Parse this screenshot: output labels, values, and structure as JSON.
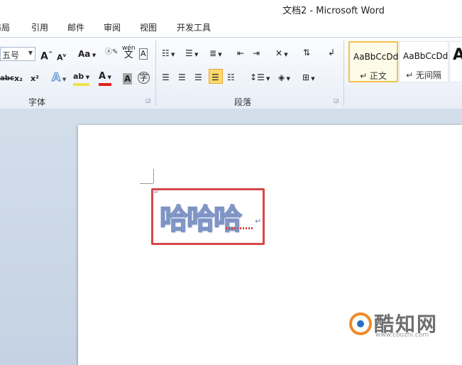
{
  "window": {
    "title": "文档2 - Microsoft Word"
  },
  "menu": {
    "items": [
      "布局",
      "引用",
      "邮件",
      "审阅",
      "视图",
      "开发工具"
    ]
  },
  "ribbon": {
    "font": {
      "size_value": "五号",
      "grow_label": "A",
      "shrink_label": "A",
      "change_case_label": "Aa",
      "phonetic_label": "wén",
      "enclose_label": "A",
      "strike_label": "abc",
      "subscript_label": "x₂",
      "superscript_label": "x²",
      "text_effect_label": "A",
      "highlight_label": "ab",
      "font_color_label": "A",
      "char_shading_label": "A",
      "enclose_char_label": "字",
      "group_label": "字体"
    },
    "paragraph": {
      "group_label": "段落"
    },
    "styles": {
      "items": [
        {
          "sample": "AaBbCcDd",
          "name": "↵ 正文",
          "selected": true
        },
        {
          "sample": "AaBbCcDd",
          "name": "↵ 无间隔",
          "selected": false
        },
        {
          "sample": "A",
          "name": "",
          "selected": false
        }
      ]
    },
    "accent_color": "#ffd969"
  },
  "document": {
    "text": "哈哈哈",
    "paragraph_mark": "↵",
    "highlight_color": "#d9464b"
  },
  "watermark": {
    "brand": "酷知网",
    "url": "www.coozhi.com"
  }
}
